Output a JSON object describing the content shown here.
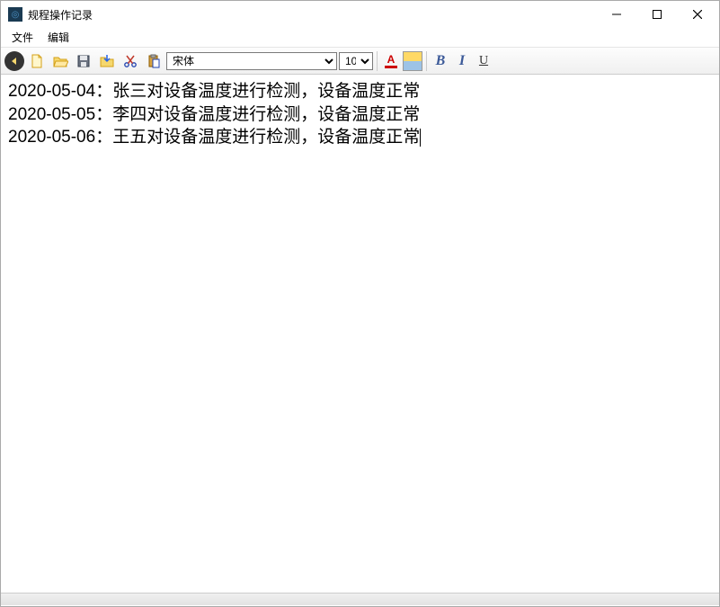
{
  "window": {
    "title": "规程操作记录"
  },
  "menu": {
    "file": "文件",
    "edit": "编辑"
  },
  "toolbar": {
    "font_name": "宋体",
    "font_size": "10",
    "font_color_label": "A",
    "bold_label": "B",
    "italic_label": "I",
    "underline_label": "U"
  },
  "editor": {
    "lines": [
      "2020-05-04：张三对设备温度进行检测，设备温度正常",
      "2020-05-05：李四对设备温度进行检测，设备温度正常",
      "2020-05-06：王五对设备温度进行检测，设备温度正常"
    ]
  }
}
